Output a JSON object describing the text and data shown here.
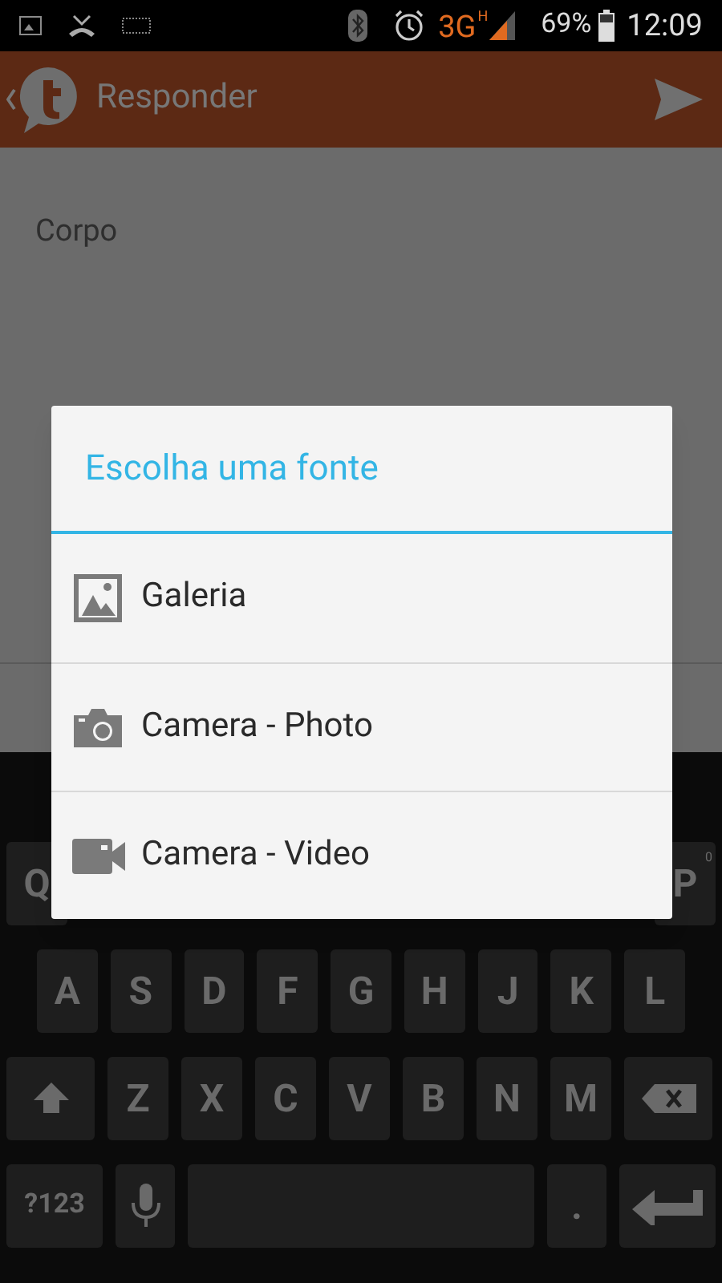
{
  "status_bar": {
    "network": "3G",
    "network_sub": "H",
    "battery": "69%",
    "time": "12:09"
  },
  "app_bar": {
    "title": "Responder"
  },
  "compose": {
    "placeholder": "Corpo"
  },
  "dialog": {
    "title": "Escolha uma fonte",
    "items": [
      {
        "kind": "gallery",
        "label": "Galeria"
      },
      {
        "kind": "photo",
        "label": "Camera - Photo"
      },
      {
        "kind": "video",
        "label": "Camera - Video"
      }
    ]
  },
  "keyboard": {
    "rows": [
      {
        "keys": [
          {
            "kind": "letter",
            "label": "Q"
          },
          {
            "kind": "gap"
          },
          {
            "kind": "letter",
            "label": "P",
            "hint": "0"
          }
        ]
      },
      {
        "keys": [
          {
            "kind": "letter",
            "label": "A"
          },
          {
            "kind": "letter",
            "label": "S"
          },
          {
            "kind": "letter",
            "label": "D"
          },
          {
            "kind": "letter",
            "label": "F"
          },
          {
            "kind": "letter",
            "label": "G"
          },
          {
            "kind": "letter",
            "label": "H"
          },
          {
            "kind": "letter",
            "label": "J"
          },
          {
            "kind": "letter",
            "label": "K"
          },
          {
            "kind": "letter",
            "label": "L"
          }
        ]
      },
      {
        "keys": [
          {
            "kind": "shift"
          },
          {
            "kind": "letter",
            "label": "Z"
          },
          {
            "kind": "letter",
            "label": "X"
          },
          {
            "kind": "letter",
            "label": "C"
          },
          {
            "kind": "letter",
            "label": "V"
          },
          {
            "kind": "letter",
            "label": "B"
          },
          {
            "kind": "letter",
            "label": "N"
          },
          {
            "kind": "letter",
            "label": "M"
          },
          {
            "kind": "backspace"
          }
        ]
      },
      {
        "keys": [
          {
            "kind": "symbols",
            "label": "?123"
          },
          {
            "kind": "mic"
          },
          {
            "kind": "space"
          },
          {
            "kind": "period",
            "label": "."
          },
          {
            "kind": "enter"
          }
        ]
      }
    ]
  }
}
